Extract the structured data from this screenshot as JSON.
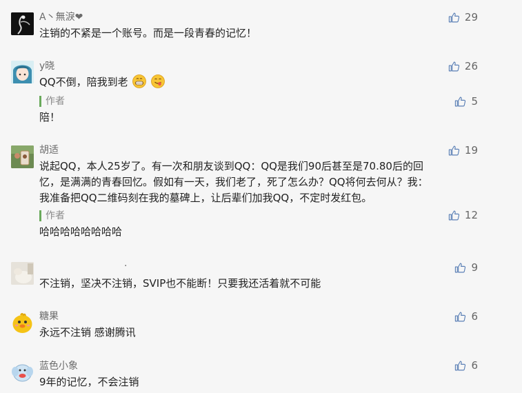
{
  "comments": [
    {
      "username": "A丶無淚❤",
      "likes": "29",
      "text": "注销的不紧是一个账号。而是一段青春的记忆！"
    },
    {
      "username": "y晓",
      "likes": "26",
      "text": "QQ不倒，陪我到老",
      "emoji": [
        "grinning-face-emoji",
        "yum-face-emoji"
      ],
      "reply": {
        "author": "作者",
        "likes": "5",
        "text": "陪！"
      }
    },
    {
      "username": "胡适",
      "likes": "19",
      "text_lines": [
        "说起QQ，本人25岁了。有一次和朋友谈到QQ：QQ是我们90后甚至是70.80后的回",
        "忆，是满满的青春回忆。假如有一天，我们老了，死了怎么办？QQ将何去何从？我：",
        "我准备把QQ二维码刻在我的墓碑上，让后辈们加我QQ，不定时发红包。"
      ],
      "reply": {
        "author": "作者",
        "likes": "12",
        "text": "哈哈哈哈哈哈哈哈"
      }
    },
    {
      "username": ".",
      "likes": "9",
      "text": "不注销，坚决不注销，SVIP也不能断！只要我还活着就不可能"
    },
    {
      "username": "糖果",
      "likes": "6",
      "text": "永远不注销 感谢腾讯"
    },
    {
      "username": "蓝色小象",
      "likes": "6",
      "text": "9年的记忆，不会注销"
    }
  ]
}
